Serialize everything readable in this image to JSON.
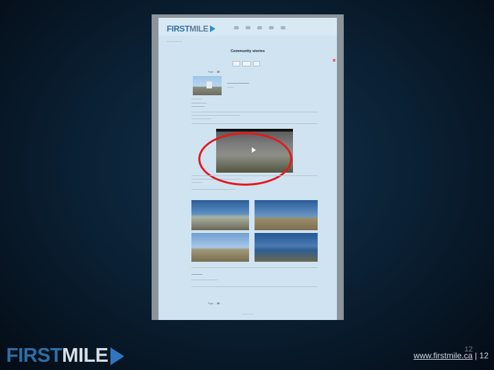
{
  "screenshot": {
    "header": {
      "logo_first": "FIRST",
      "logo_mile": "MILE"
    },
    "page_title": "Community stories",
    "pager_label": "Page",
    "pager_current": "22",
    "colors": {
      "highlight_ring": "#e4191b",
      "brand_blue": "#2e6ea3"
    }
  },
  "footer": {
    "logo_first": "FIRST",
    "logo_mile": "MILE",
    "url": "www.firstmile.ca",
    "page_overlay": "12",
    "separator": "|",
    "page_number": "12"
  }
}
